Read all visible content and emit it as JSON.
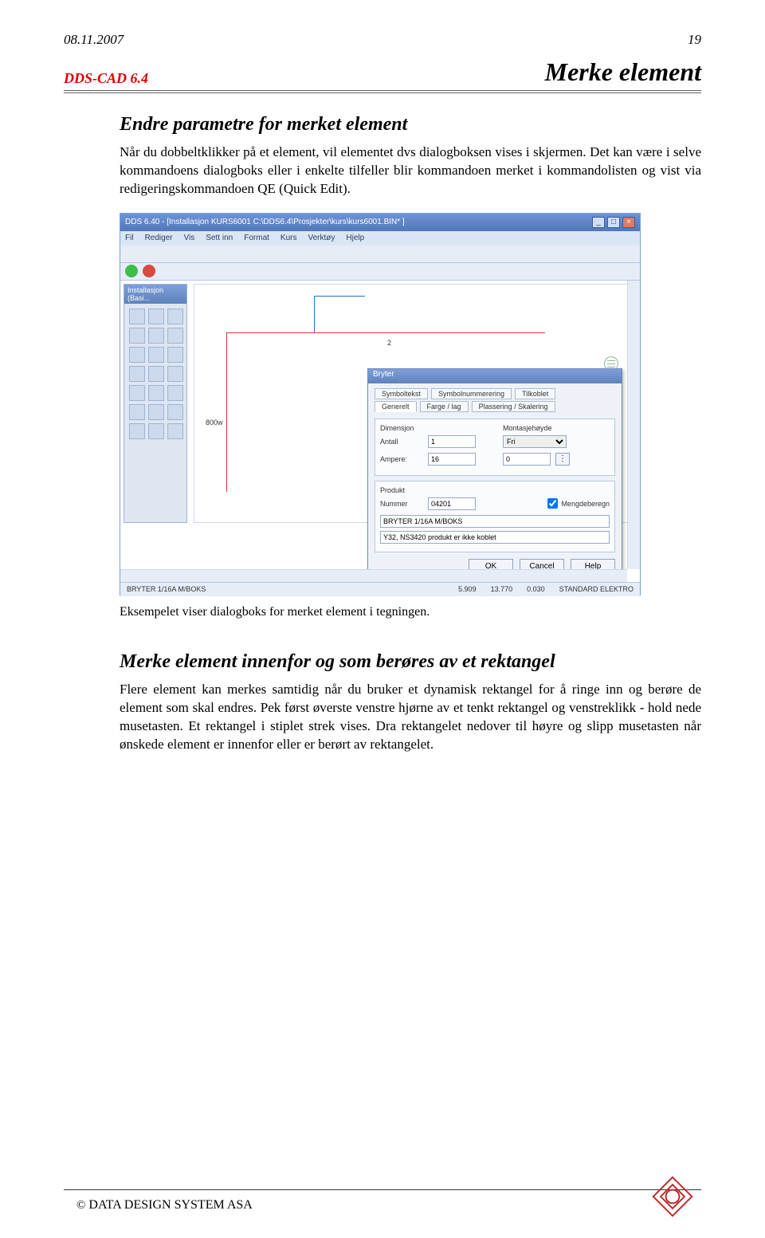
{
  "meta": {
    "date": "08.11.2007",
    "page_num": "19"
  },
  "header": {
    "product": "DDS-CAD 6.4",
    "doc_title": "Merke element"
  },
  "section1": {
    "heading": "Endre parametre for merket element",
    "p": "Når du dobbeltklikker på et element, vil elementet dvs dialogboksen vises i skjermen. Det kan være i selve kommandoens dialogboks eller i enkelte tilfeller blir kommandoen merket i kommandolisten og vist via redigeringskommandoen QE (Quick Edit)."
  },
  "screenshot": {
    "app_title": "DDS 6.40 - [Installasjon  KURS6001  C:\\DDS6.4\\Prosjekter\\kurs\\kurs6001.BIN* ]",
    "menu": [
      "Fil",
      "Rediger",
      "Vis",
      "Sett inn",
      "Format",
      "Kurs",
      "Verktøy",
      "Hjelp"
    ],
    "sidepanel_title": "Installasjon (Basi...",
    "drawing": {
      "label_800w": "800w",
      "dim_2": "2"
    },
    "dialog": {
      "title": "Bryter",
      "tabs_row1": [
        "Symboltekst",
        "Symbolnummerering",
        "Tilkoblet"
      ],
      "tabs_row2": [
        "Generelt",
        "Farge / lag",
        "Plassering / Skalering"
      ],
      "group_dim": "Dimensjon",
      "group_mount": "Montasjehøyde",
      "lbl_antall": "Antall",
      "val_antall": "1",
      "lbl_ampere": "Ampere:",
      "val_ampere": "16",
      "sel_fri": "Fri",
      "val_zero": "0",
      "group_prod": "Produkt",
      "lbl_nummer": "Nummer",
      "val_nummer": "04201",
      "chk_mengde": "Mengdeberegn",
      "line1": "BRYTER 1/16A M/BOKS",
      "line2": "Y32, NS3420 produkt er ikke koblet",
      "btn_ok": "OK",
      "btn_cancel": "Cancel",
      "btn_help": "Help"
    },
    "status": {
      "left": "BRYTER 1/16A M/BOKS",
      "c1": "5.909",
      "c2": "13.770",
      "c3": "0.030",
      "right": "STANDARD ELEKTRO"
    }
  },
  "caption": "Eksempelet viser dialogboks for merket element i tegningen.",
  "section2": {
    "heading": "Merke element innenfor og som berøres av et rektangel",
    "p": "Flere element kan merkes samtidig når du bruker et dynamisk rektangel for å ringe inn og berøre de element som skal endres. Pek først øverste venstre hjørne av et tenkt rektangel og venstreklikk - hold nede musetasten. Et rektangel i stiplet strek vises. Dra rektangelet nedover til høyre og slipp musetasten når ønskede element er innenfor eller er berørt av rektangelet."
  },
  "footer": {
    "copyright_symbol": "©",
    "company": " DATA DESIGN SYSTEM ASA"
  }
}
